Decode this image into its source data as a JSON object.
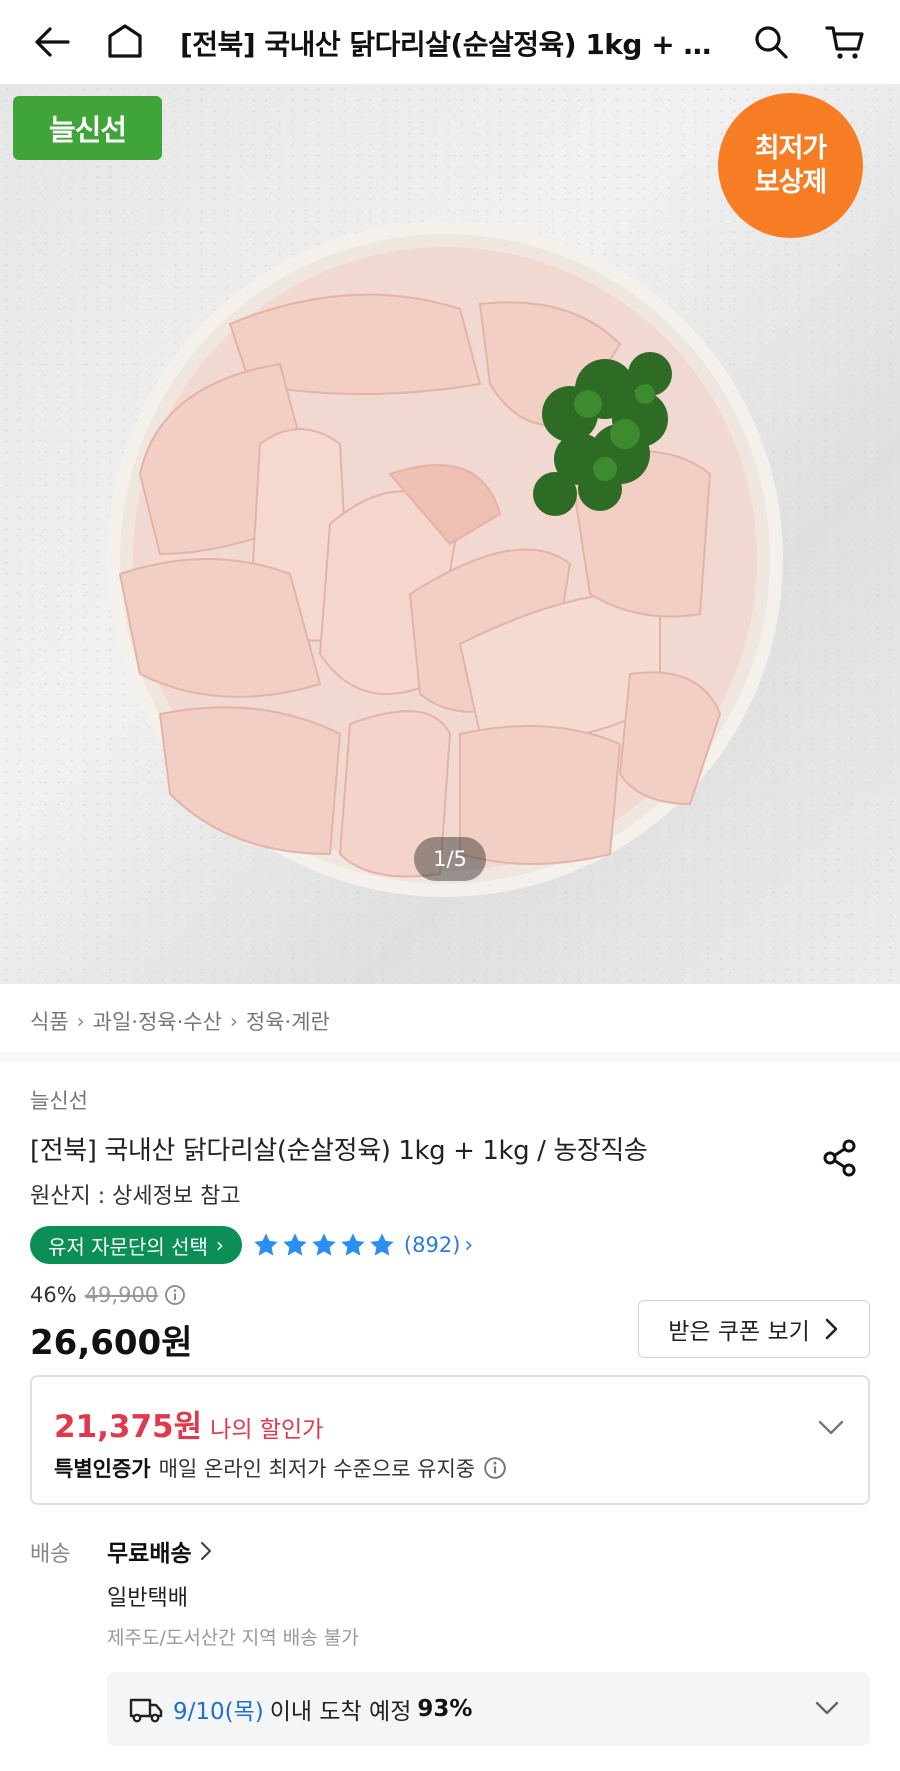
{
  "header": {
    "title": "[전북] 국내산 닭다리살(순살정육) 1kg + 1kg / 농장직송",
    "back_icon": "arrow-left-icon",
    "home_icon": "home-icon",
    "search_icon": "search-icon",
    "cart_icon": "cart-icon"
  },
  "hero": {
    "brand_badge": "늘신선",
    "price_badge_line1": "최저가",
    "price_badge_line2": "보상제",
    "counter": "1/5",
    "brand_color": "#3fa53a",
    "badge_color": "#f77d25"
  },
  "breadcrumb": [
    "식품",
    "과일·정육·수산",
    "정육·계란"
  ],
  "product": {
    "seller": "늘신선",
    "title": "[전북] 국내산 닭다리살(순살정육) 1kg + 1kg / 농장직송",
    "origin": "원산지 : 상세정보 참고",
    "pick_badge": "유저 자문단의 선택",
    "rating_stars": 5,
    "review_count": "(892)",
    "discount_rate": "46%",
    "original_price": "49,900",
    "price": "26,600원",
    "coupon_button": "받은 쿠폰 보기"
  },
  "my_discount": {
    "price": "21,375원",
    "label": "나의 할인가",
    "cert_strong": "특별인증가",
    "cert_text": "매일 온라인 최저가 수준으로 유지중",
    "accent": "#e0394d"
  },
  "shipping": {
    "label": "배송",
    "type": "무료배송",
    "method": "일반택배",
    "note": "제주도/도서산간 지역 배송 불가",
    "eta_date": "9/10(목)",
    "eta_text": "이내 도착 예정",
    "eta_pct": "93%"
  }
}
